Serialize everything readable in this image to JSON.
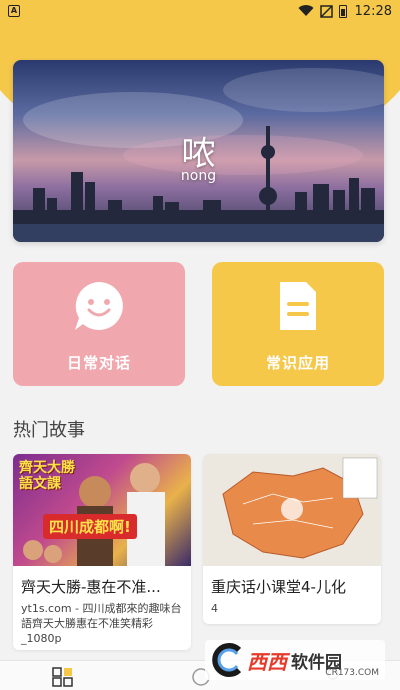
{
  "status_bar": {
    "app_badge": "A",
    "time": "12:28"
  },
  "hero": {
    "character": "哝",
    "pinyin": "nong"
  },
  "categories": [
    {
      "label": "日常对话",
      "icon": "chat-smile-icon",
      "color": "#f0a8ae"
    },
    {
      "label": "常识应用",
      "icon": "document-icon",
      "color": "#f5c84a"
    }
  ],
  "section": {
    "title": "热门故事"
  },
  "stories": [
    {
      "title": "齊天大勝-惠在不准...",
      "desc": "yt1s.com - 四川成都來的趣味台語齊天大勝惠在不准笑精彩_1080p",
      "thumb_text_top": "齊天大勝",
      "thumb_text_sub": "語文課",
      "thumb_banner": "四川成都啊!"
    },
    {
      "title": "重庆话小课堂4-儿化",
      "desc": "4"
    }
  ],
  "watermark": {
    "brand": "西西",
    "name": "软件园",
    "url": "CR173.COM"
  },
  "colors": {
    "accent_yellow": "#f5c84a",
    "accent_pink": "#f0a8ae",
    "background": "#f2f2f2"
  }
}
